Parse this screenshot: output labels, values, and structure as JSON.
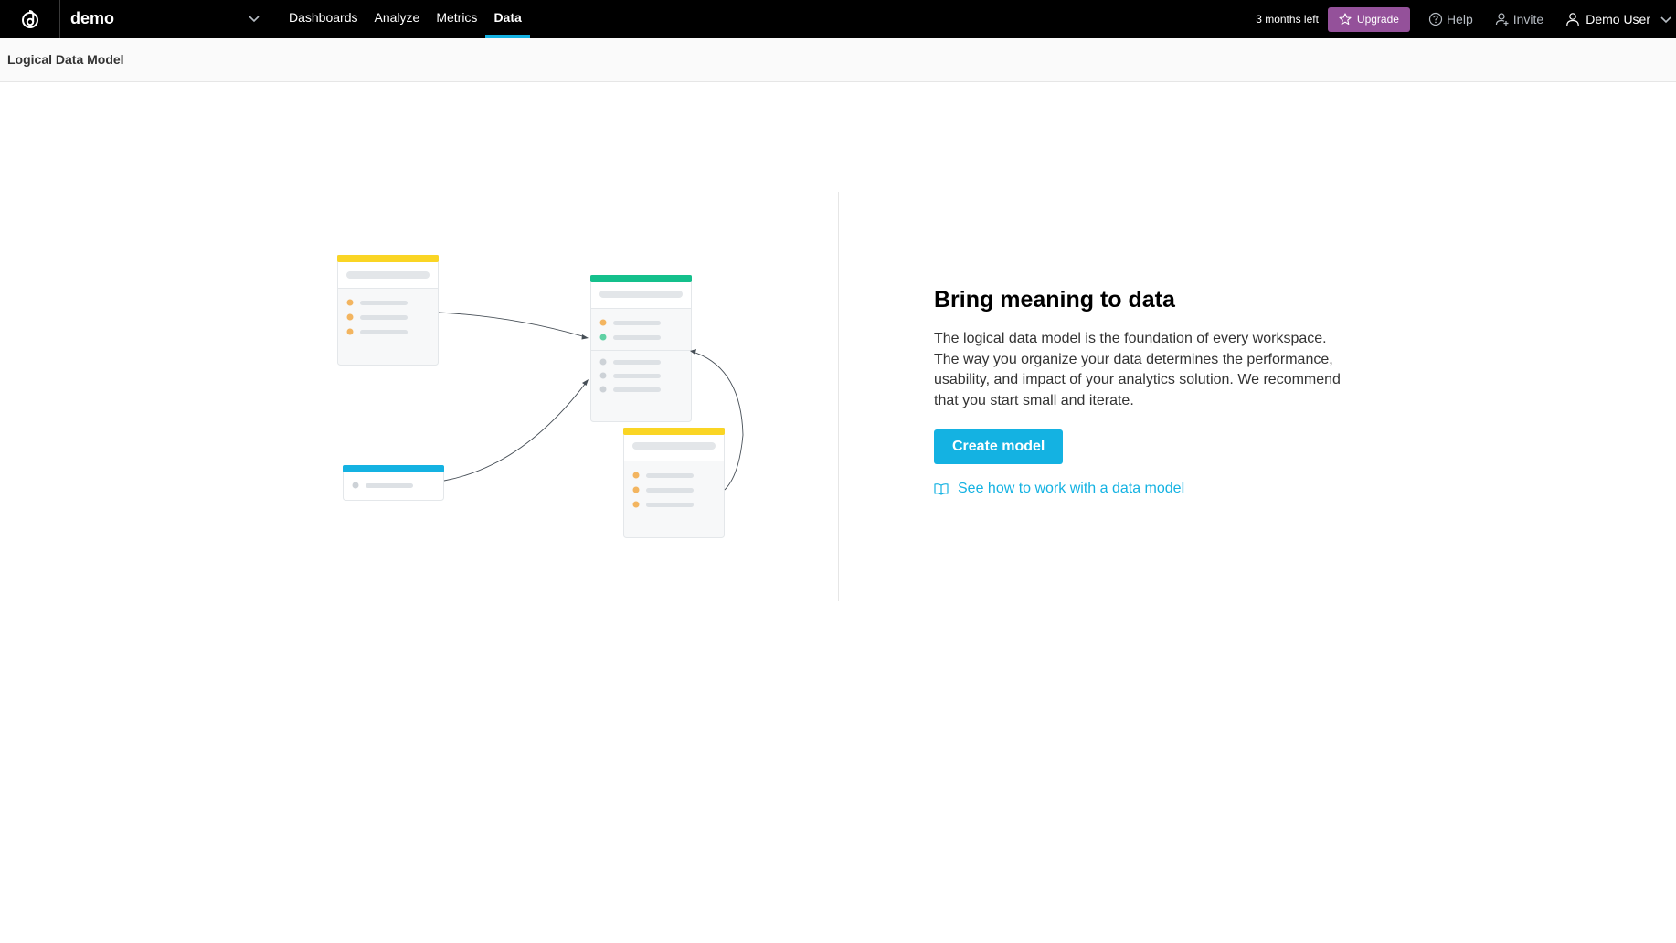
{
  "app": {
    "workspace_name": "demo",
    "accent_color": "#14b2e2",
    "upgrade_color": "#94519a"
  },
  "nav": {
    "items": [
      {
        "label": "Dashboards",
        "active": false
      },
      {
        "label": "Analyze",
        "active": false
      },
      {
        "label": "Metrics",
        "active": false
      },
      {
        "label": "Data",
        "active": true
      }
    ]
  },
  "topright": {
    "trial_text": "3 months left",
    "upgrade_label": "Upgrade",
    "help_label": "Help",
    "invite_label": "Invite",
    "user_label": "Demo User"
  },
  "page": {
    "title": "Logical Data Model"
  },
  "main": {
    "heading": "Bring meaning to data",
    "description": "The logical data model is the foundation of every workspace. The way you organize your data determines the performance, usability, and impact of your analytics solution. We recommend that you start small and iterate.",
    "create_button": "Create model",
    "help_link": "See how to work with a data model"
  },
  "icons": {
    "logo": "gooddata-logo-icon",
    "workspace_chevron": "chevron-down-icon",
    "upgrade": "star-icon",
    "help": "question-circle-icon",
    "invite": "add-person-icon",
    "user": "person-icon",
    "user_chevron": "chevron-down-icon",
    "help_link": "book-icon"
  }
}
